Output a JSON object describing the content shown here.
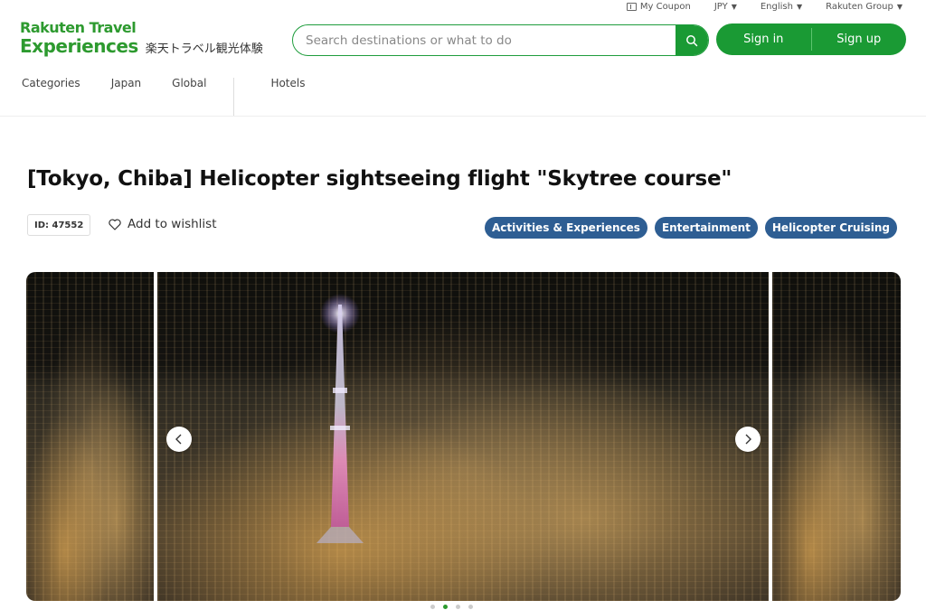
{
  "utility_bar": {
    "coupon_label": "My Coupon",
    "currency_label": "JPY",
    "language_label": "English",
    "group_label": "Rakuten Group"
  },
  "logo": {
    "line1": "Rakuten Travel",
    "line2": "Experiences",
    "japanese": "楽天トラベル観光体験"
  },
  "search": {
    "placeholder": "Search destinations or what to do",
    "value": ""
  },
  "auth": {
    "signin_label": "Sign in",
    "signup_label": "Sign up"
  },
  "nav": {
    "items": [
      {
        "label": "Categories"
      },
      {
        "label": "Japan"
      },
      {
        "label": "Global"
      },
      {
        "label": "Hotels"
      }
    ]
  },
  "product": {
    "title": "[Tokyo, Chiba] Helicopter sightseeing flight \"Skytree course\"",
    "id_label": "ID: 47552",
    "wishlist_label": "Add to wishlist",
    "tags": [
      {
        "label": "Activities & Experiences"
      },
      {
        "label": "Entertainment"
      },
      {
        "label": "Helicopter Cruising"
      }
    ]
  },
  "gallery": {
    "dot_count": 4,
    "active_index": 1
  },
  "colors": {
    "brand_green": "#1a9a34",
    "tag_blue": "#2e5e93"
  }
}
